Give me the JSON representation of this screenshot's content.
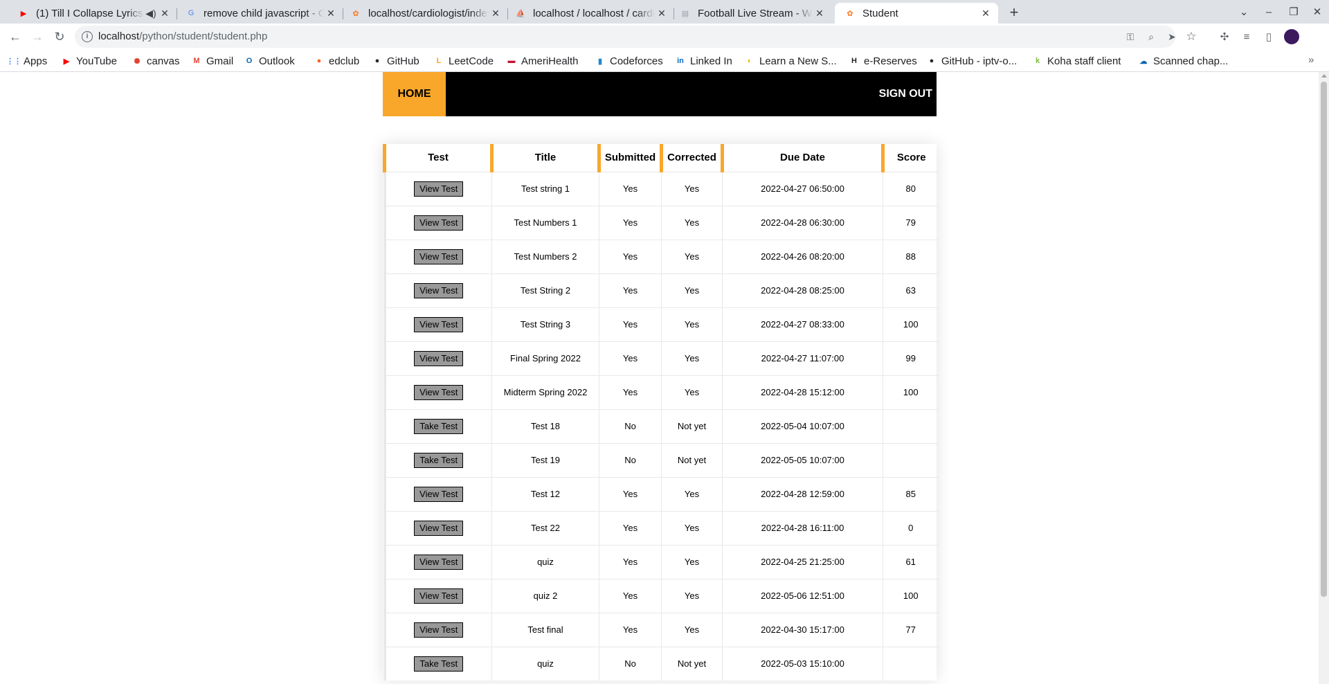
{
  "browser": {
    "tabs": [
      {
        "title": "(1) Till I Collapse Lyrics",
        "icon": "youtube-icon",
        "active": false
      },
      {
        "title": "remove child javascript - Google Search",
        "icon": "google-icon",
        "active": false
      },
      {
        "title": "localhost/cardiologist/index.php",
        "icon": "xampp-icon",
        "active": false
      },
      {
        "title": "localhost / localhost / cardiologist",
        "icon": "phpmyadmin-icon",
        "active": false
      },
      {
        "title": "Football Live Stream - Watch",
        "icon": "page-icon",
        "active": false
      },
      {
        "title": "Student",
        "icon": "xampp-icon",
        "active": true
      }
    ],
    "url_host": "localhost",
    "url_path": "/python/student/student.php",
    "bookmarks": [
      {
        "label": "Apps",
        "icon": "apps-icon",
        "color": "#4285f4"
      },
      {
        "label": "YouTube",
        "icon": "youtube-icon",
        "color": "#ff0000"
      },
      {
        "label": "canvas",
        "icon": "canvas-icon",
        "color": "#e13f2b"
      },
      {
        "label": "Gmail",
        "icon": "gmail-icon",
        "color": "#ea4335"
      },
      {
        "label": "Outlook",
        "icon": "outlook-icon",
        "color": "#0a64ad"
      },
      {
        "label": "edclub",
        "icon": "edclub-icon",
        "color": "#f26722"
      },
      {
        "label": "GitHub",
        "icon": "github-icon",
        "color": "#24292e"
      },
      {
        "label": "LeetCode",
        "icon": "leetcode-icon",
        "color": "#ffa116"
      },
      {
        "label": "AmeriHealth",
        "icon": "amerihealth-icon",
        "color": "#c8102e"
      },
      {
        "label": "Codeforces",
        "icon": "codeforces-icon",
        "color": "#1f8acb"
      },
      {
        "label": "Linked In",
        "icon": "linkedin-icon",
        "color": "#0a66c2"
      },
      {
        "label": "Learn a New S...",
        "icon": "learn-icon",
        "color": "#f4b400"
      },
      {
        "label": "e-Reserves",
        "icon": "ereserves-icon",
        "color": "#222222"
      },
      {
        "label": "GitHub - iptv-o...",
        "icon": "github-icon",
        "color": "#24292e"
      },
      {
        "label": "Koha staff client",
        "icon": "koha-icon",
        "color": "#7dbb3c"
      },
      {
        "label": "Scanned chap...",
        "icon": "onedrive-icon",
        "color": "#0a64ad"
      }
    ]
  },
  "nav": {
    "home": "HOME",
    "signout": "SIGN OUT"
  },
  "table": {
    "headers": [
      "Test",
      "Title",
      "Submitted",
      "Corrected",
      "Due Date",
      "Score"
    ],
    "rows": [
      {
        "action": "View Test",
        "title": "Test string 1",
        "submitted": "Yes",
        "corrected": "Yes",
        "due": "2022-04-27 06:50:00",
        "score": "80"
      },
      {
        "action": "View Test",
        "title": "Test Numbers 1",
        "submitted": "Yes",
        "corrected": "Yes",
        "due": "2022-04-28 06:30:00",
        "score": "79"
      },
      {
        "action": "View Test",
        "title": "Test Numbers 2",
        "submitted": "Yes",
        "corrected": "Yes",
        "due": "2022-04-26 08:20:00",
        "score": "88"
      },
      {
        "action": "View Test",
        "title": "Test String 2",
        "submitted": "Yes",
        "corrected": "Yes",
        "due": "2022-04-28 08:25:00",
        "score": "63"
      },
      {
        "action": "View Test",
        "title": "Test String 3",
        "submitted": "Yes",
        "corrected": "Yes",
        "due": "2022-04-27 08:33:00",
        "score": "100"
      },
      {
        "action": "View Test",
        "title": "Final Spring 2022",
        "submitted": "Yes",
        "corrected": "Yes",
        "due": "2022-04-27 11:07:00",
        "score": "99"
      },
      {
        "action": "View Test",
        "title": "Midterm Spring 2022",
        "submitted": "Yes",
        "corrected": "Yes",
        "due": "2022-04-28 15:12:00",
        "score": "100"
      },
      {
        "action": "Take Test",
        "title": "Test 18",
        "submitted": "No",
        "corrected": "Not yet",
        "due": "2022-05-04 10:07:00",
        "score": ""
      },
      {
        "action": "Take Test",
        "title": "Test 19",
        "submitted": "No",
        "corrected": "Not yet",
        "due": "2022-05-05 10:07:00",
        "score": ""
      },
      {
        "action": "View Test",
        "title": "Test 12",
        "submitted": "Yes",
        "corrected": "Yes",
        "due": "2022-04-28 12:59:00",
        "score": "85"
      },
      {
        "action": "View Test",
        "title": "Test 22",
        "submitted": "Yes",
        "corrected": "Yes",
        "due": "2022-04-28 16:11:00",
        "score": "0"
      },
      {
        "action": "View Test",
        "title": "quiz",
        "submitted": "Yes",
        "corrected": "Yes",
        "due": "2022-04-25 21:25:00",
        "score": "61"
      },
      {
        "action": "View Test",
        "title": "quiz 2",
        "submitted": "Yes",
        "corrected": "Yes",
        "due": "2022-05-06 12:51:00",
        "score": "100"
      },
      {
        "action": "View Test",
        "title": "Test final",
        "submitted": "Yes",
        "corrected": "Yes",
        "due": "2022-04-30 15:17:00",
        "score": "77"
      },
      {
        "action": "Take Test",
        "title": "quiz",
        "submitted": "No",
        "corrected": "Not yet",
        "due": "2022-05-03 15:10:00",
        "score": ""
      }
    ]
  },
  "colors": {
    "accent": "#f9a72b",
    "navbar": "#000000",
    "button": "#999999"
  }
}
